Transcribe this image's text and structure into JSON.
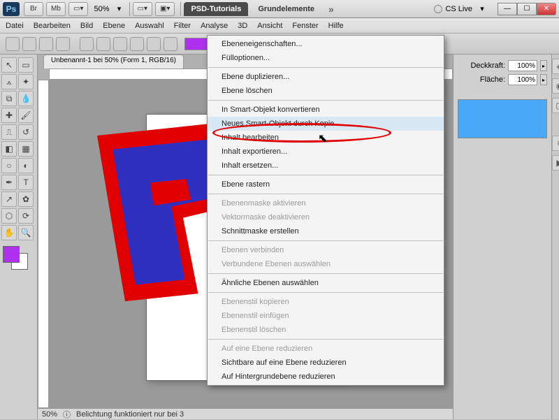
{
  "titlebar": {
    "app_abbr": "Ps",
    "br": "Br",
    "mb": "Mb",
    "zoom": "50%",
    "tab1": "PSD-Tutorials",
    "tab2": "Grundelemente",
    "cslive": "CS Live"
  },
  "menubar": [
    "Datei",
    "Bearbeiten",
    "Bild",
    "Ebene",
    "Auswahl",
    "Filter",
    "Analyse",
    "3D",
    "Ansicht",
    "Fenster",
    "Hilfe"
  ],
  "doc_tab": "Unbenannt-1 bei 50% (Form 1, RGB/16)",
  "status": {
    "zoom": "50%",
    "text": "Belichtung funktioniert nur bei 3"
  },
  "props": {
    "opacity_label": "Deckkraft:",
    "opacity_value": "100%",
    "fill_label": "Fläche:",
    "fill_value": "100%"
  },
  "context_menu": {
    "items": [
      {
        "label": "Ebeneneigenschaften...",
        "enabled": true
      },
      {
        "label": "Fülloptionen...",
        "enabled": true
      },
      {
        "sep": true
      },
      {
        "label": "Ebene duplizieren...",
        "enabled": true
      },
      {
        "label": "Ebene löschen",
        "enabled": true
      },
      {
        "sep": true
      },
      {
        "label": "In Smart-Objekt konvertieren",
        "enabled": true
      },
      {
        "label": "Neues Smart-Objekt durch Kopie",
        "enabled": true,
        "highlight": true
      },
      {
        "label": "Inhalt bearbeiten",
        "enabled": true
      },
      {
        "label": "Inhalt exportieren...",
        "enabled": true
      },
      {
        "label": "Inhalt ersetzen...",
        "enabled": true
      },
      {
        "sep": true
      },
      {
        "label": "Ebene rastern",
        "enabled": true
      },
      {
        "sep": true
      },
      {
        "label": "Ebenenmaske aktivieren",
        "enabled": false
      },
      {
        "label": "Vektormaske deaktivieren",
        "enabled": false
      },
      {
        "label": "Schnittmaske erstellen",
        "enabled": true
      },
      {
        "sep": true
      },
      {
        "label": "Ebenen verbinden",
        "enabled": false
      },
      {
        "label": "Verbundene Ebenen auswählen",
        "enabled": false
      },
      {
        "sep": true
      },
      {
        "label": "Ähnliche Ebenen auswählen",
        "enabled": true
      },
      {
        "sep": true
      },
      {
        "label": "Ebenenstil kopieren",
        "enabled": false
      },
      {
        "label": "Ebenenstil einfügen",
        "enabled": false
      },
      {
        "label": "Ebenenstil löschen",
        "enabled": false
      },
      {
        "sep": true
      },
      {
        "label": "Auf eine Ebene reduzieren",
        "enabled": false
      },
      {
        "label": "Sichtbare auf eine Ebene reduzieren",
        "enabled": true
      },
      {
        "label": "Auf Hintergrundebene reduzieren",
        "enabled": true
      }
    ]
  }
}
